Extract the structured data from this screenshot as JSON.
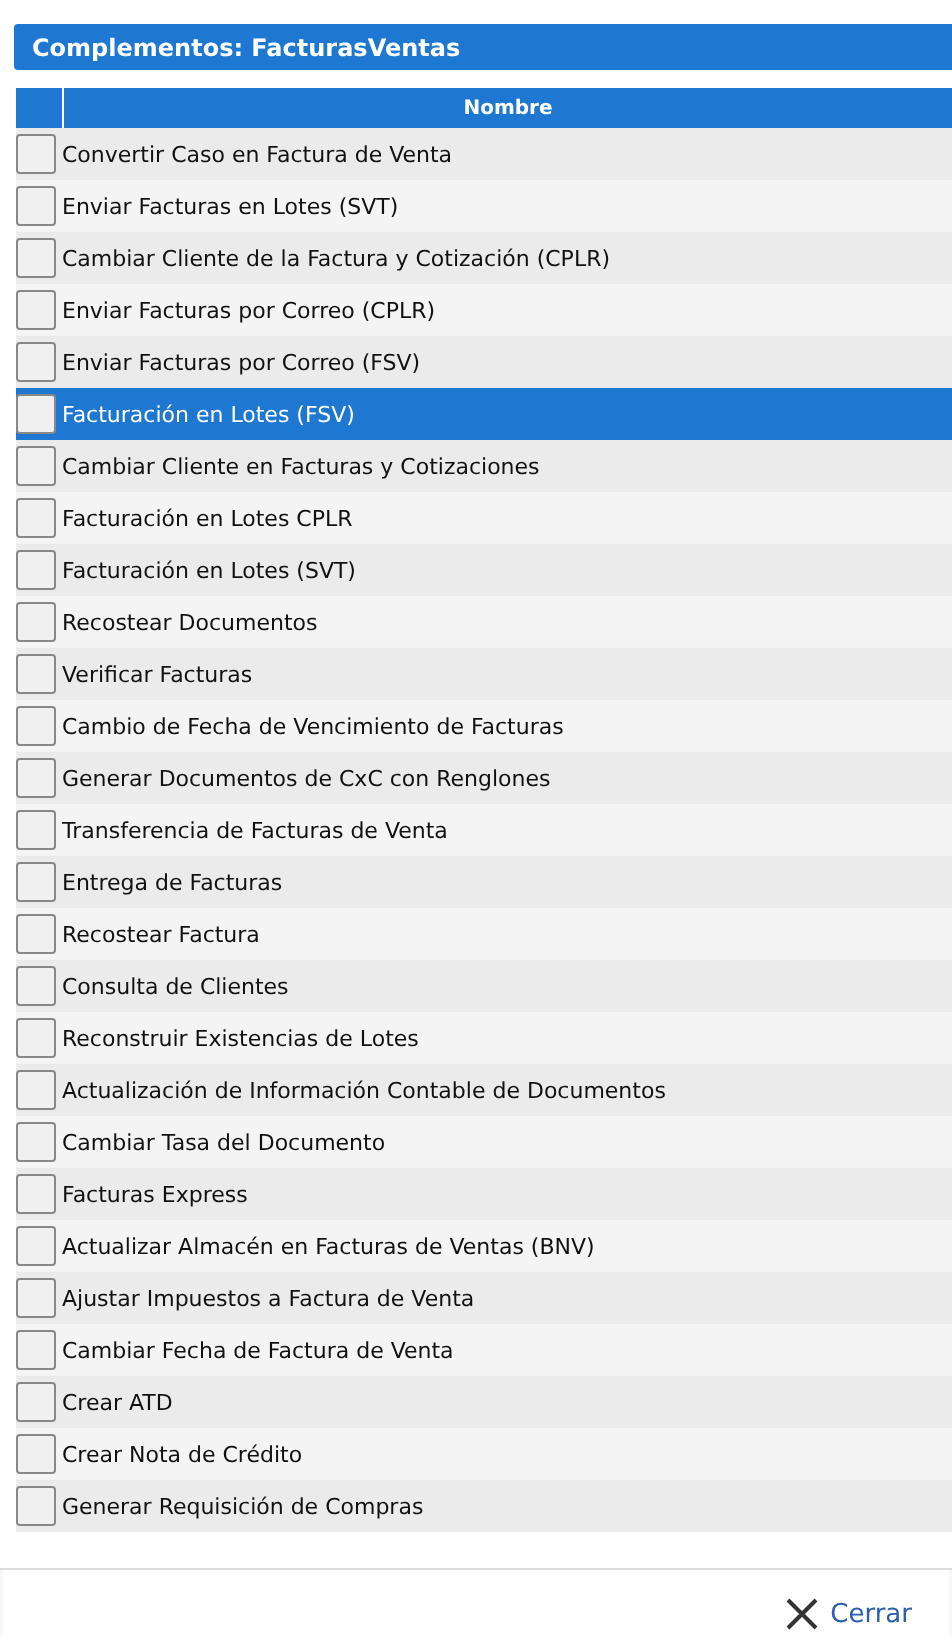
{
  "window": {
    "title": "Complementos: FacturasVentas"
  },
  "table": {
    "columns": [
      "Nombre"
    ],
    "rows": [
      {
        "name": "Convertir Caso en Factura de Venta",
        "selected": false
      },
      {
        "name": "Enviar Facturas en Lotes (SVT)",
        "selected": false
      },
      {
        "name": "Cambiar Cliente de la Factura y Cotización (CPLR)",
        "selected": false
      },
      {
        "name": "Enviar Facturas por Correo (CPLR)",
        "selected": false
      },
      {
        "name": "Enviar Facturas por Correo (FSV)",
        "selected": false
      },
      {
        "name": "Facturación en Lotes (FSV)",
        "selected": true
      },
      {
        "name": "Cambiar Cliente en Facturas y Cotizaciones",
        "selected": false
      },
      {
        "name": "Facturación en Lotes CPLR",
        "selected": false
      },
      {
        "name": "Facturación en Lotes (SVT)",
        "selected": false
      },
      {
        "name": "Recostear Documentos",
        "selected": false
      },
      {
        "name": "Verificar Facturas",
        "selected": false
      },
      {
        "name": "Cambio de Fecha de Vencimiento de Facturas",
        "selected": false
      },
      {
        "name": "Generar Documentos de CxC con Renglones",
        "selected": false
      },
      {
        "name": "Transferencia de Facturas de Venta",
        "selected": false
      },
      {
        "name": "Entrega de Facturas",
        "selected": false
      },
      {
        "name": "Recostear Factura",
        "selected": false
      },
      {
        "name": "Consulta de Clientes",
        "selected": false
      },
      {
        "name": "Reconstruir Existencias de Lotes",
        "selected": false
      },
      {
        "name": "Actualización de Información Contable de Documentos",
        "selected": false
      },
      {
        "name": "Cambiar Tasa del Documento",
        "selected": false
      },
      {
        "name": "Facturas Express",
        "selected": false
      },
      {
        "name": "Actualizar Almacén en Facturas de Ventas (BNV)",
        "selected": false
      },
      {
        "name": "Ajustar Impuestos a Factura de Venta",
        "selected": false
      },
      {
        "name": "Cambiar Fecha de Factura de Venta",
        "selected": false
      },
      {
        "name": "Crear ATD",
        "selected": false
      },
      {
        "name": "Crear Nota de Crédito",
        "selected": false
      },
      {
        "name": "Generar Requisición de Compras",
        "selected": false
      }
    ]
  },
  "footer": {
    "close_button": "Cerrar"
  }
}
